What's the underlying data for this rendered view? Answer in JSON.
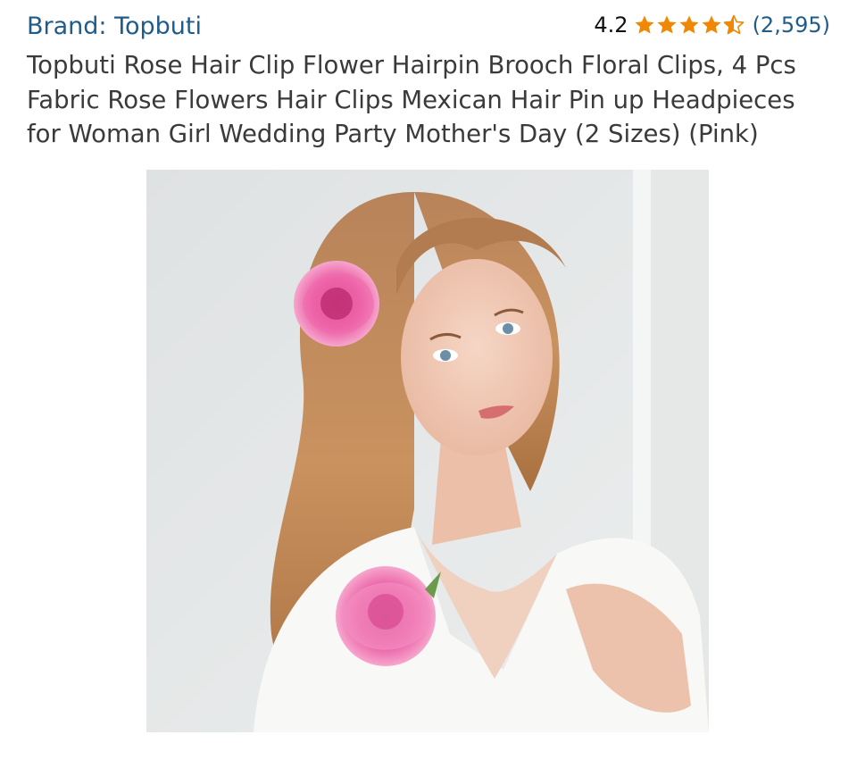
{
  "brand": {
    "label": "Brand: Topbuti"
  },
  "rating": {
    "value": "4.2",
    "stars": 4.2,
    "star_color": "#f08804",
    "count": "(2,595)"
  },
  "product": {
    "title": "Topbuti Rose Hair Clip Flower Hairpin Brooch Floral Clips, 4 Pcs Fabric Rose Flowers Hair Clips Mexican Hair Pin up Headpieces for Woman Girl Wedding Party Mother's Day (2 Sizes) (Pink)"
  },
  "colors": {
    "link": "#1f5c8a",
    "title": "#3a3a3a",
    "rose": "#e9559f"
  }
}
